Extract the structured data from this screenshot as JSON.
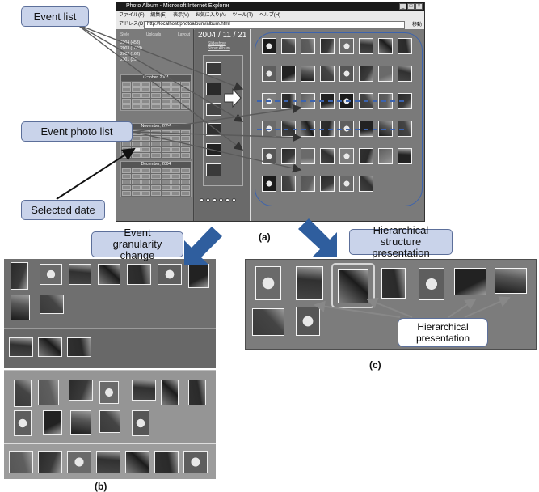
{
  "labels": {
    "event_list": "Event list",
    "event_photo_list": "Event photo list",
    "selected_date": "Selected date",
    "event_granularity": "Event granularity change",
    "hierarchical_structure": "Hierarchical structure presentation",
    "hierarchical_presentation": "Hierarchical presentation",
    "caption_a": "(a)",
    "caption_b": "(b)",
    "caption_c": "(c)"
  },
  "browser": {
    "title": "Photo Album - Microsoft Internet Explorer",
    "menu": [
      "ファイル(F)",
      "編集(E)",
      "表示(V)",
      "お気に入り(A)",
      "ツール(T)",
      "ヘルプ(H)"
    ],
    "address_label": "アドレス(D)",
    "address": "http://localhost/photoalbum/album.html",
    "go_label": "移動"
  },
  "left_pane": {
    "sort_options": [
      "Style",
      "Uploads",
      "Layout"
    ],
    "years": [
      "2004 (458)",
      "2003 (1003)",
      "2002 (162)",
      "2001 (29)"
    ],
    "calendars": [
      {
        "month": "October, 2004"
      },
      {
        "month": "November, 2004"
      },
      {
        "month": "December, 2004"
      }
    ]
  },
  "mid_pane": {
    "date": "2004 / 11 / 21",
    "links": [
      "Slideshow",
      "Show Album"
    ]
  },
  "colors": {
    "callout_fill": "#c9d3ea",
    "callout_border": "#5c6f9a",
    "arrow_blue": "#2f5e9e",
    "grid_outline": "#3c63ae"
  }
}
